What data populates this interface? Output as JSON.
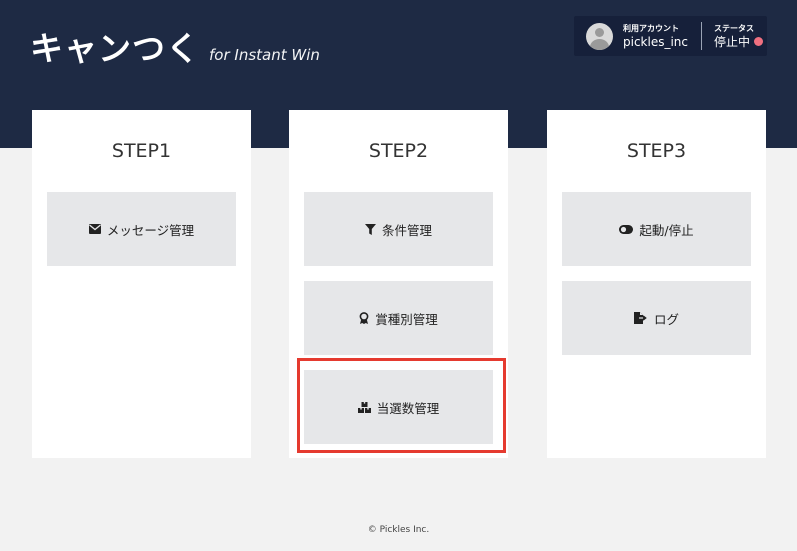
{
  "header": {
    "logo_main": "キャンつく",
    "logo_sub": "for Instant Win",
    "account_label": "利用アカウント",
    "account_name": "pickles_inc",
    "status_label": "ステータス",
    "status_value": "停止中",
    "status_color": "#f07080",
    "background_color": "#1e2a44"
  },
  "steps": [
    {
      "title": "STEP1",
      "items": [
        {
          "label": "メッセージ管理",
          "icon": "envelope-icon"
        }
      ]
    },
    {
      "title": "STEP2",
      "items": [
        {
          "label": "条件管理",
          "icon": "filter-icon"
        },
        {
          "label": "賞種別管理",
          "icon": "award-icon"
        },
        {
          "label": "当選数管理",
          "icon": "boxes-icon",
          "highlighted": true
        }
      ]
    },
    {
      "title": "STEP3",
      "items": [
        {
          "label": "起動/停止",
          "icon": "toggle-icon"
        },
        {
          "label": "ログ",
          "icon": "file-export-icon"
        }
      ]
    }
  ],
  "highlight_color": "#e53a2f",
  "footer": {
    "copyright": "© Pickles Inc."
  }
}
